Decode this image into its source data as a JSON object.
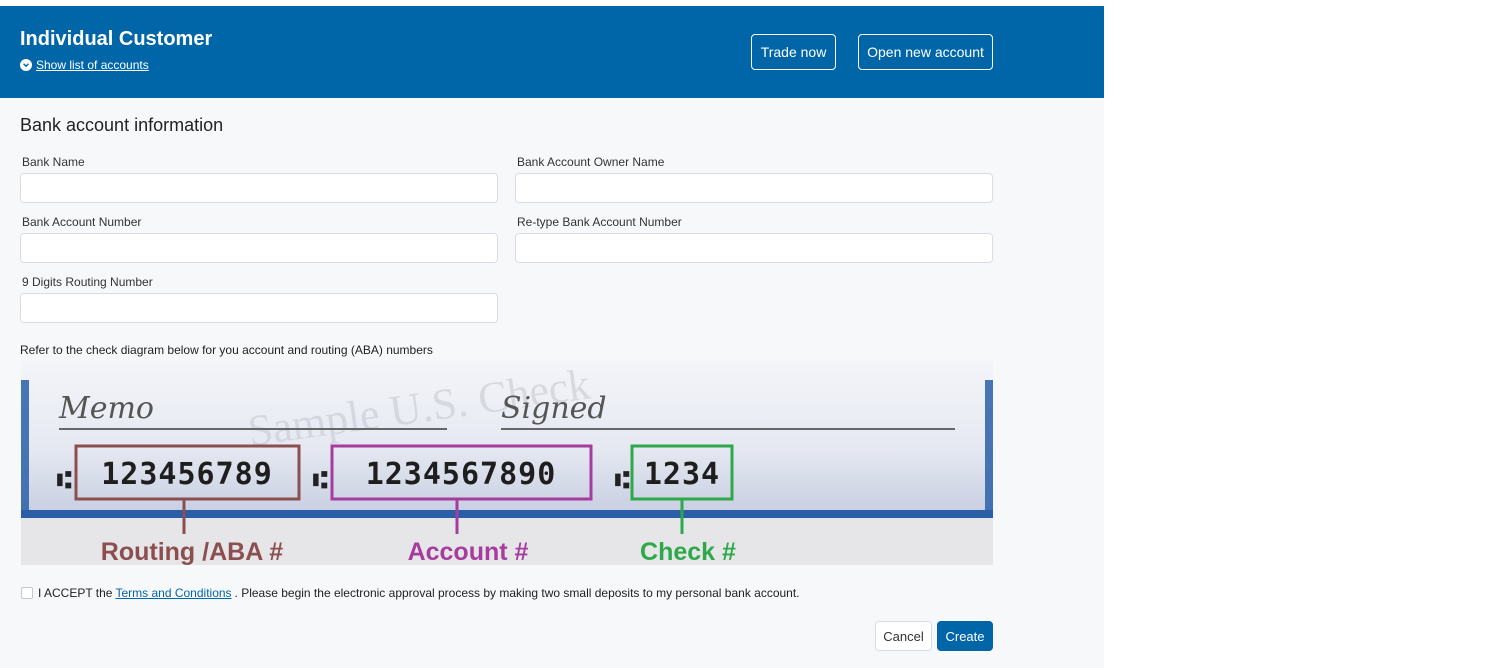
{
  "header": {
    "title": "Individual Customer",
    "accounts_link": "Show list of accounts",
    "trade_button": "Trade now",
    "open_account_button": "Open new account"
  },
  "form": {
    "section_title": "Bank account information",
    "fields": {
      "bank_name": {
        "label": "Bank Name",
        "value": ""
      },
      "owner_name": {
        "label": "Bank Account Owner Name",
        "value": ""
      },
      "account_number": {
        "label": "Bank Account Number",
        "value": ""
      },
      "retype_account_number": {
        "label": "Re-type Bank Account Number",
        "value": ""
      },
      "routing_number": {
        "label": "9 Digits Routing Number",
        "value": ""
      }
    },
    "refer_text": "Refer to the check diagram below for you account and routing (ABA) numbers"
  },
  "check_diagram": {
    "memo": "Memo",
    "signed": "Signed",
    "watermark": "Sample U.S. Check",
    "routing_digits": "123456789",
    "account_digits": "1234567890",
    "check_digits": "1234",
    "routing_caption": "Routing /ABA #",
    "account_caption": "Account #",
    "check_caption": "Check #",
    "colors": {
      "routing": "#8b4f4f",
      "account": "#a63d9e",
      "check": "#2ea84a",
      "band": "#2a5fa8"
    }
  },
  "terms": {
    "checked": false,
    "prefix": "I ACCEPT the",
    "link": "Terms and Conditions",
    "suffix": ". Please begin the electronic approval process by making two small deposits to my personal bank account."
  },
  "actions": {
    "cancel": "Cancel",
    "create": "Create"
  },
  "colors": {
    "brand": "#0066a8",
    "background": "#f7f8fa"
  }
}
